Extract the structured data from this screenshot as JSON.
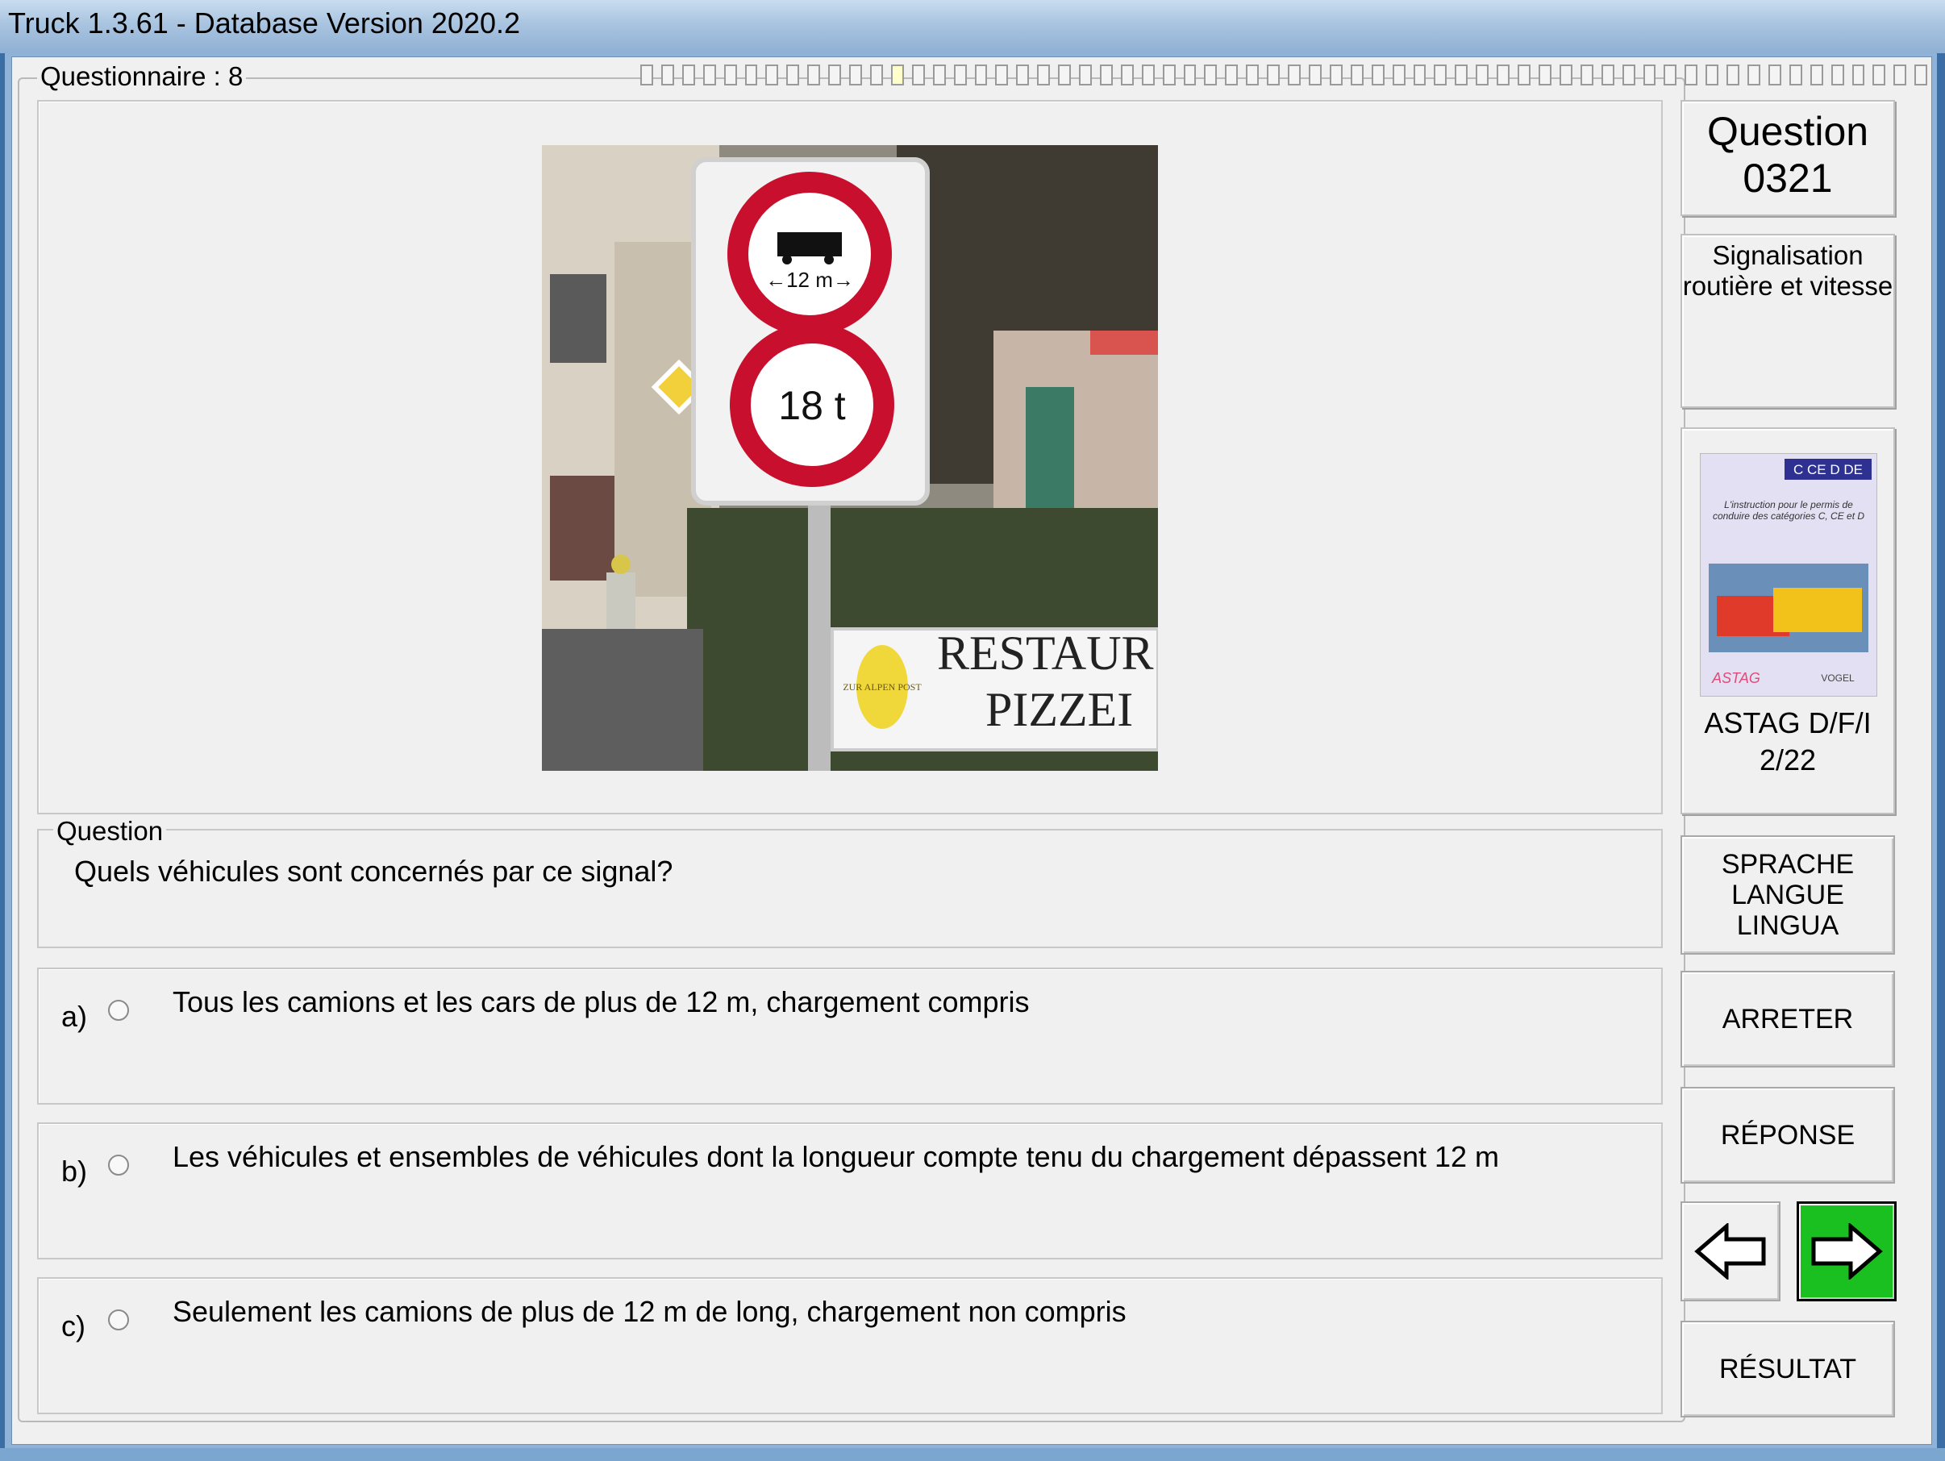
{
  "window": {
    "title": "Truck 1.3.61 - Database Version 2020.2"
  },
  "questionnaire": {
    "label": "Questionnaire : 8",
    "progress_total": 62,
    "progress_current": 12
  },
  "image": {
    "sign_top_text": "←12 m→",
    "sign_bottom_text": "18 t",
    "restaurant_line1": "RESTAUR",
    "restaurant_line2": "PIZZEI",
    "badge_text": "ZUR ALPEN POST"
  },
  "question": {
    "legend": "Question",
    "text": "Quels véhicules sont concernés par ce signal?"
  },
  "answers": [
    {
      "letter": "a)",
      "text": "Tous les camions et les cars de plus de 12 m, chargement compris"
    },
    {
      "letter": "b)",
      "text": "Les véhicules et ensembles de véhicules dont la longueur compte tenu du chargement dépassent 12 m"
    },
    {
      "letter": "c)",
      "text": "Seulement les camions de plus de 12 m de long, chargement non compris"
    }
  ],
  "sidebar": {
    "question_label": "Question",
    "question_number": "0321",
    "category_line1": "Signalisation",
    "category_line2": "routière et vitesse",
    "book": {
      "cover_badge": "C CE D DE",
      "cover_text": "L'instruction pour le permis de conduire des catégories C, CE et D",
      "publisher_left": "ASTAG",
      "publisher_right": "VOGEL",
      "caption_line1": "ASTAG D/F/I",
      "caption_line2": "2/22"
    },
    "lang_button": [
      "SPRACHE",
      "LANGUE",
      "LINGUA"
    ],
    "stop_button": "ARRETER",
    "answer_button": "RÉPONSE",
    "prev_icon": "arrow-left-icon",
    "next_icon": "arrow-right-icon",
    "result_button": "RÉSULTAT"
  },
  "colors": {
    "next_button": "#19c01f",
    "sign_red": "#c8102e"
  }
}
